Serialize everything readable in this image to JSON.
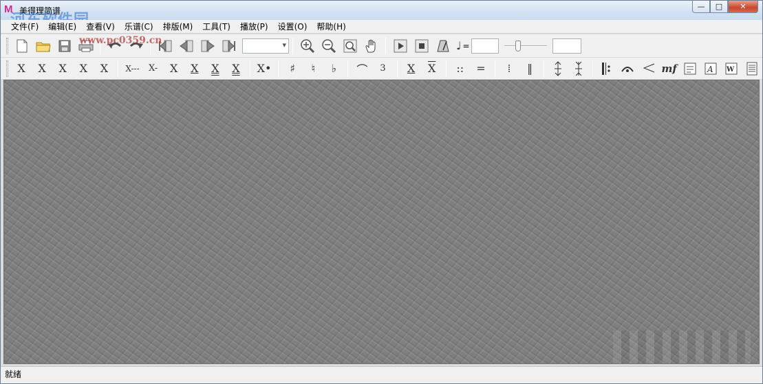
{
  "window": {
    "title": "美得理简谱",
    "watermark_text": "河东软件园",
    "watermark_url": "www.pc0359.cn",
    "controls": {
      "minimize": "—",
      "maximize": "□",
      "close": "✕"
    }
  },
  "menu": [
    {
      "label": "文件(F)"
    },
    {
      "label": "编辑(E)"
    },
    {
      "label": "查看(V)"
    },
    {
      "label": "乐谱(C)"
    },
    {
      "label": "排版(M)"
    },
    {
      "label": "工具(T)"
    },
    {
      "label": "播放(P)"
    },
    {
      "label": "设置(O)"
    },
    {
      "label": "帮助(H)"
    }
  ],
  "toolbar1": {
    "icons": [
      "new-file-icon",
      "open-folder-icon",
      "save-icon",
      "print-icon",
      "undo-icon",
      "redo-icon",
      "first-page-icon",
      "prev-page-icon",
      "next-page-icon",
      "last-page-icon",
      "zoom-in-icon",
      "zoom-out-icon",
      "zoom-fit-icon",
      "hand-pan-icon",
      "play-icon",
      "stop-icon",
      "metronome-icon"
    ],
    "page_combo_value": "",
    "tempo_equals": "=",
    "tempo_value": "",
    "volume_value": ""
  },
  "toolbar2": {
    "note_buttons": [
      "X",
      "X",
      "X",
      "X",
      "X",
      "X---",
      "X-",
      "X",
      "X",
      "X",
      "X",
      "X•"
    ],
    "accidentals": [
      "♯",
      "♮",
      "♭"
    ],
    "misc": [
      "⌒",
      "3",
      "X",
      "X",
      "::",
      "=",
      "⁞",
      "‖"
    ]
  },
  "status": {
    "text": "就绪"
  }
}
